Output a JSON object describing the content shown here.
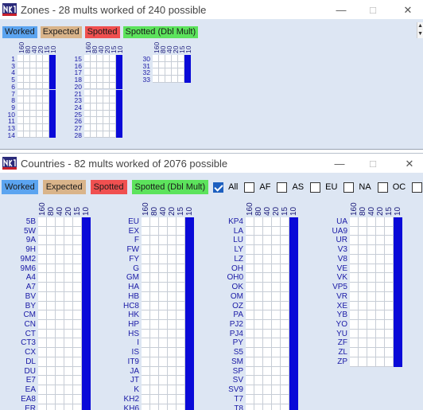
{
  "zones_window": {
    "title": "Zones - 28 mults worked of 240 possible",
    "legend": [
      {
        "label": "Worked",
        "color": "#5ba4f0"
      },
      {
        "label": "Expected",
        "color": "#d9b48a"
      },
      {
        "label": "Spotted",
        "color": "#f05050"
      },
      {
        "label": "Spotted (Dbl Mult)",
        "color": "#5ce35c"
      }
    ],
    "band_headers": [
      "160",
      "80",
      "40",
      "20",
      "15",
      "10"
    ],
    "columns": [
      {
        "labels": [
          "1",
          "3",
          "4",
          "5",
          "6",
          "7",
          "8",
          "9",
          "10",
          "11",
          "13",
          "14"
        ]
      },
      {
        "labels": [
          "15",
          "16",
          "17",
          "18",
          "20",
          "21",
          "23",
          "24",
          "25",
          "26",
          "27",
          "28"
        ]
      },
      {
        "labels": [
          "30",
          "31",
          "32",
          "33"
        ]
      }
    ],
    "worked_band": "10"
  },
  "countries_window": {
    "title": "Countries - 82 mults worked of 2076 possible",
    "legend": [
      {
        "label": "Worked",
        "color": "#5ba4f0"
      },
      {
        "label": "Expected",
        "color": "#d9b48a"
      },
      {
        "label": "Spotted",
        "color": "#f05050"
      },
      {
        "label": "Spotted (Dbl Mult)",
        "color": "#5ce35c"
      }
    ],
    "filters": [
      {
        "label": "All",
        "checked": true
      },
      {
        "label": "AF",
        "checked": false
      },
      {
        "label": "AS",
        "checked": false
      },
      {
        "label": "EU",
        "checked": false
      },
      {
        "label": "NA",
        "checked": false
      },
      {
        "label": "OC",
        "checked": false
      },
      {
        "label": "S",
        "checked": false
      }
    ],
    "band_headers": [
      "160",
      "80",
      "40",
      "20",
      "15",
      "10"
    ],
    "columns": [
      {
        "labels": [
          "5B",
          "5W",
          "9A",
          "9H",
          "9M2",
          "9M6",
          "A4",
          "A7",
          "BV",
          "BY",
          "CM",
          "CN",
          "CT",
          "CT3",
          "CX",
          "DL",
          "DU",
          "E7",
          "EA",
          "EA8",
          "ER",
          "ES"
        ]
      },
      {
        "labels": [
          "EU",
          "EX",
          "F",
          "FW",
          "FY",
          "G",
          "GM",
          "HA",
          "HB",
          "HC8",
          "HK",
          "HP",
          "HS",
          "I",
          "IS",
          "IT9",
          "JA",
          "JT",
          "K",
          "KH2",
          "KH6",
          "KL"
        ]
      },
      {
        "labels": [
          "KP4",
          "LA",
          "LU",
          "LY",
          "LZ",
          "OH",
          "OH0",
          "OK",
          "OM",
          "OZ",
          "PA",
          "PJ2",
          "PJ4",
          "PY",
          "S5",
          "SM",
          "SP",
          "SV",
          "SV9",
          "T7",
          "T8",
          "TI"
        ]
      },
      {
        "labels": [
          "UA",
          "UA9",
          "UR",
          "V3",
          "V8",
          "VE",
          "VK",
          "VP5",
          "VR",
          "XE",
          "YB",
          "YO",
          "YU",
          "ZF",
          "ZL",
          "ZP"
        ]
      }
    ],
    "worked_band": "10"
  }
}
